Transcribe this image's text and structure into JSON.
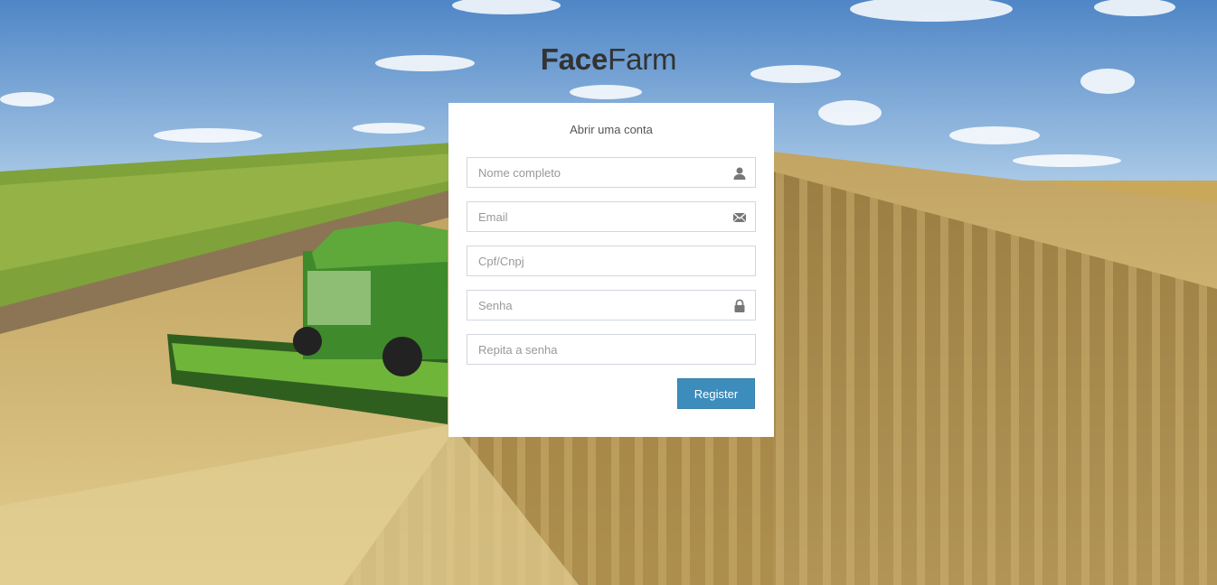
{
  "brand": {
    "name_bold": "Face",
    "name_light": "Farm"
  },
  "form": {
    "title": "Abrir uma conta",
    "fields": [
      {
        "placeholder": "Nome completo",
        "icon": "user-icon"
      },
      {
        "placeholder": "Email",
        "icon": "envelope-icon"
      },
      {
        "placeholder": "Cpf/Cnpj",
        "icon": ""
      },
      {
        "placeholder": "Senha",
        "icon": "lock-icon"
      },
      {
        "placeholder": "Repita a senha",
        "icon": ""
      }
    ],
    "submit_label": "Register"
  },
  "colors": {
    "button": "#3c8dbc",
    "button_border": "#367fa9",
    "card": "#ffffff",
    "input_border": "#d2d6de",
    "icon": "#777777"
  }
}
